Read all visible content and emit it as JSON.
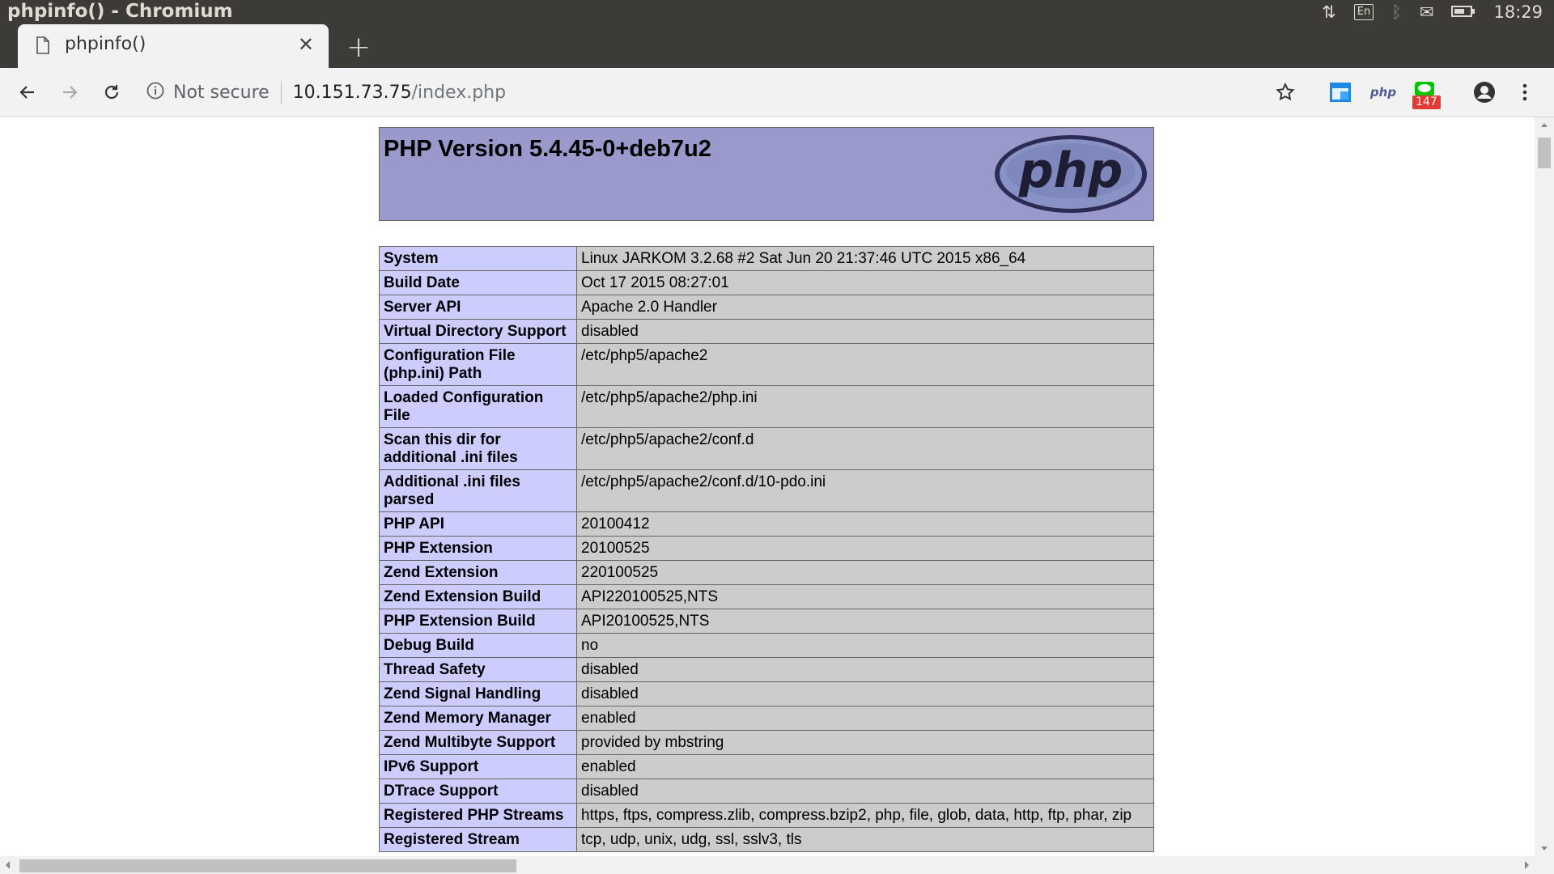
{
  "window": {
    "title": "phpinfo() - Chromium"
  },
  "tray": {
    "lang": "En",
    "clock": "18:29"
  },
  "tab": {
    "title": "phpinfo()",
    "close": "✕",
    "new_tab": "+"
  },
  "address": {
    "not_secure": "Not secure",
    "host": "10.151.73.75",
    "path": "/index.php"
  },
  "extensions": {
    "php_label": "php",
    "badge_count": "147"
  },
  "page": {
    "version_title": "PHP Version 5.4.45-0+deb7u2",
    "logo_text": "php",
    "rows": [
      {
        "key": "System",
        "value": "Linux JARKOM 3.2.68 #2 Sat Jun 20 21:37:46 UTC 2015 x86_64"
      },
      {
        "key": "Build Date",
        "value": "Oct 17 2015 08:27:01"
      },
      {
        "key": "Server API",
        "value": "Apache 2.0 Handler"
      },
      {
        "key": "Virtual Directory Support",
        "value": "disabled"
      },
      {
        "key": "Configuration File (php.ini) Path",
        "value": "/etc/php5/apache2"
      },
      {
        "key": "Loaded Configuration File",
        "value": "/etc/php5/apache2/php.ini"
      },
      {
        "key": "Scan this dir for additional .ini files",
        "value": "/etc/php5/apache2/conf.d"
      },
      {
        "key": "Additional .ini files parsed",
        "value": "/etc/php5/apache2/conf.d/10-pdo.ini"
      },
      {
        "key": "PHP API",
        "value": "20100412"
      },
      {
        "key": "PHP Extension",
        "value": "20100525"
      },
      {
        "key": "Zend Extension",
        "value": "220100525"
      },
      {
        "key": "Zend Extension Build",
        "value": "API220100525,NTS"
      },
      {
        "key": "PHP Extension Build",
        "value": "API20100525,NTS"
      },
      {
        "key": "Debug Build",
        "value": "no"
      },
      {
        "key": "Thread Safety",
        "value": "disabled"
      },
      {
        "key": "Zend Signal Handling",
        "value": "disabled"
      },
      {
        "key": "Zend Memory Manager",
        "value": "enabled"
      },
      {
        "key": "Zend Multibyte Support",
        "value": "provided by mbstring"
      },
      {
        "key": "IPv6 Support",
        "value": "enabled"
      },
      {
        "key": "DTrace Support",
        "value": "disabled"
      },
      {
        "key": "Registered PHP Streams",
        "value": "https, ftps, compress.zlib, compress.bzip2, php, file, glob, data, http, ftp, phar, zip"
      },
      {
        "key": "Registered Stream",
        "value": "tcp, udp, unix, udg, ssl, sslv3, tls"
      }
    ]
  },
  "colors": {
    "header_bg": "#9999cc",
    "key_bg": "#ccccff",
    "value_bg": "#cccccc",
    "chrome_dark": "#3c3b37"
  }
}
